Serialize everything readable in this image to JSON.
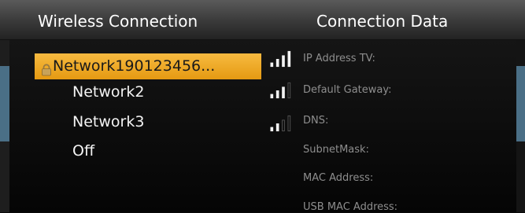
{
  "header": {
    "left_title": "Wireless Connection",
    "right_title": "Connection Data"
  },
  "networks": [
    {
      "label": "Network190123456...",
      "selected": true,
      "locked": true,
      "signal_bars": 4,
      "signal_total": 4
    },
    {
      "label": "Network2",
      "selected": false,
      "locked": false,
      "signal_bars": 3,
      "signal_total": 4
    },
    {
      "label": "Network3",
      "selected": false,
      "locked": false,
      "signal_bars": 2,
      "signal_total": 4
    },
    {
      "label": "Off",
      "selected": false,
      "locked": false
    }
  ],
  "connection_data": [
    {
      "label": "IP Address TV:"
    },
    {
      "label": "Default Gateway:"
    },
    {
      "label": "DNS:"
    },
    {
      "label": "SubnetMask:"
    },
    {
      "label": "MAC Address:"
    },
    {
      "label": "USB MAC Address:"
    }
  ],
  "colors": {
    "selection": "#f0a92a",
    "accent": "#4a6f86",
    "signal_on": "#f2f2f2",
    "signal_off": "#3a3a3a"
  },
  "icons": {
    "lock": "lock-icon",
    "signal": "wifi-signal-icon"
  }
}
